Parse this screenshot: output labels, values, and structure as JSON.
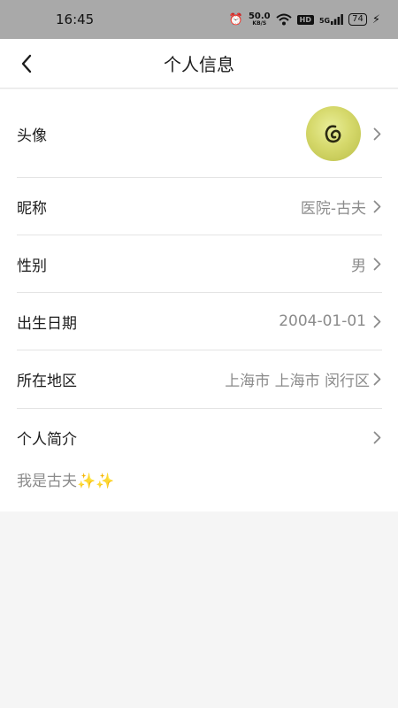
{
  "status_bar": {
    "time": "16:45",
    "net_speed": "50.0",
    "net_unit": "KB/S",
    "hd": "HD",
    "signal": "5G",
    "battery": "74"
  },
  "nav": {
    "title": "个人信息"
  },
  "rows": {
    "avatar": {
      "label": "头像"
    },
    "nickname": {
      "label": "昵称",
      "value": "医院-古夫"
    },
    "gender": {
      "label": "性别",
      "value": "男"
    },
    "birthday": {
      "label": "出生日期",
      "value": "2004-01-01"
    },
    "region": {
      "label": "所在地区",
      "value": "上海市 上海市 闵行区"
    },
    "bio": {
      "label": "个人简介",
      "value": "我是古夫✨✨"
    }
  },
  "colors": {
    "status_bar_bg": "#a9a9a9",
    "card_bg": "#ffffff",
    "page_bg": "#f5f5f5",
    "value_text": "#8b8b8b",
    "label_text": "#1c1c1c"
  }
}
